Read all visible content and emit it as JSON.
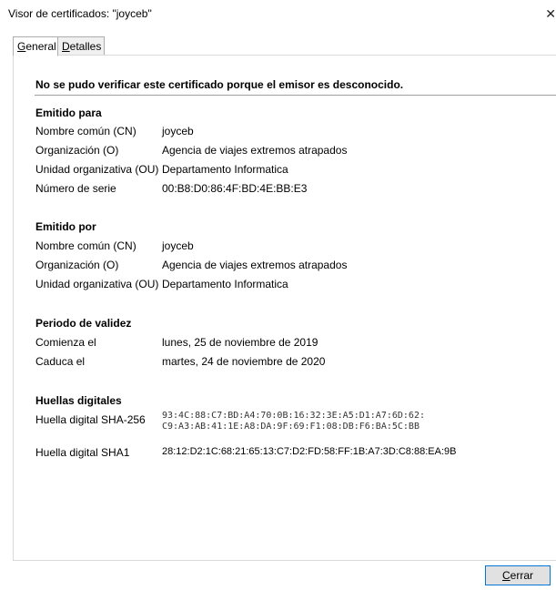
{
  "window": {
    "title": "Visor de certificados: \"joyceb\"",
    "close_glyph": "✕"
  },
  "tabs": [
    {
      "accel": "G",
      "rest": "eneral",
      "active": true
    },
    {
      "accel": "D",
      "rest": "etalles",
      "active": false
    }
  ],
  "warning": "No se pudo verificar este certificado porque el emisor es desconocido.",
  "issued_to": {
    "title": "Emitido para",
    "rows": [
      {
        "label": "Nombre común (CN)",
        "value": "joyceb"
      },
      {
        "label": "Organización (O)",
        "value": "Agencia de viajes extremos atrapados"
      },
      {
        "label": "Unidad organizativa (OU)",
        "value": "Departamento Informatica"
      },
      {
        "label": "Número de serie",
        "value": "00:B8:D0:86:4F:BD:4E:BB:E3"
      }
    ]
  },
  "issued_by": {
    "title": "Emitido por",
    "rows": [
      {
        "label": "Nombre común (CN)",
        "value": "joyceb"
      },
      {
        "label": "Organización (O)",
        "value": "Agencia de viajes extremos atrapados"
      },
      {
        "label": "Unidad organizativa (OU)",
        "value": "Departamento Informatica"
      }
    ]
  },
  "validity": {
    "title": "Periodo de validez",
    "rows": [
      {
        "label": "Comienza el",
        "value": "lunes, 25 de noviembre de 2019"
      },
      {
        "label": "Caduca el",
        "value": "martes, 24 de noviembre de 2020"
      }
    ]
  },
  "fingerprints": {
    "title": "Huellas digitales",
    "sha256_label": "Huella digital SHA-256",
    "sha256_line1": "93:4C:88:C7:BD:A4:70:0B:16:32:3E:A5:D1:A7:6D:62:",
    "sha256_line2": "C9:A3:AB:41:1E:A8:DA:9F:69:F1:08:DB:F6:BA:5C:BB",
    "sha1_label": "Huella digital SHA1",
    "sha1_value": "28:12:D2:1C:68:21:65:13:C7:D2:FD:58:FF:1B:A7:3D:C8:88:EA:9B"
  },
  "footer": {
    "close_accel": "C",
    "close_rest": "errar"
  }
}
